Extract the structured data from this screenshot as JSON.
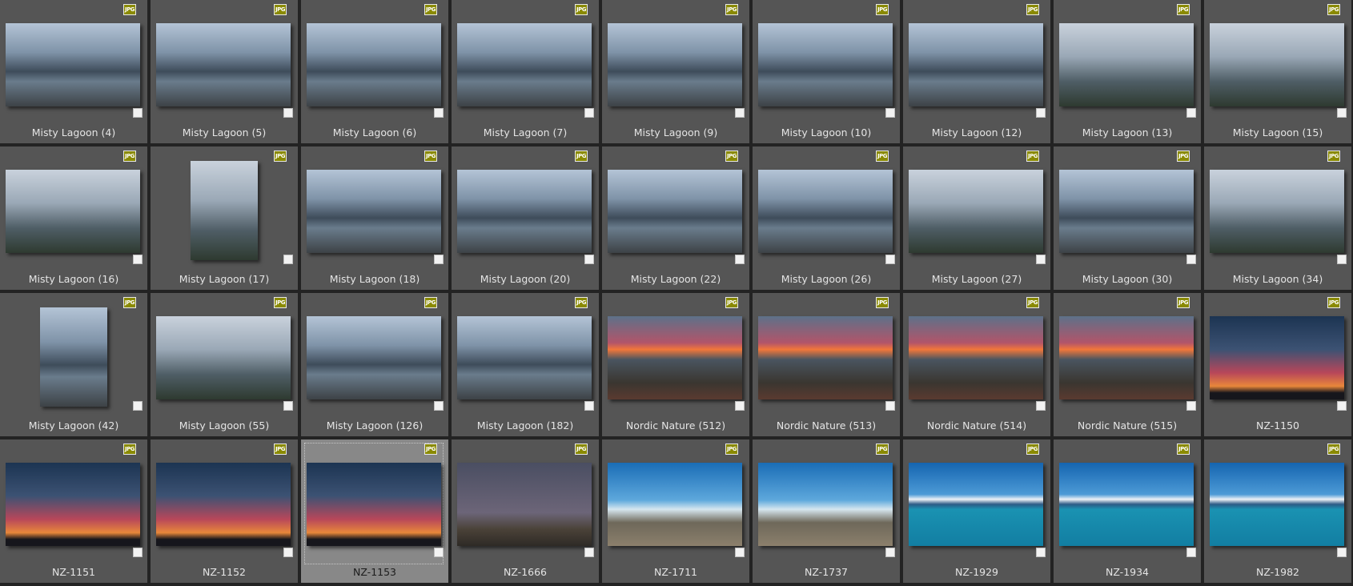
{
  "badge_text": "JPG",
  "palettes": {
    "misty": "linear-gradient(180deg,#b4c4d6 0%,#7f93a8 35%,#3e4c5a 58%,#6a7c8c 70%,#3d4246 100%)",
    "fog": "linear-gradient(180deg,#c9d2dc 0%,#9aa8b6 40%,#4f5e66 70%,#2e3a30 100%)",
    "nordic": "linear-gradient(180deg,#5d7189 0%,#b2556a 32%,#f2773a 40%,#4a5560 52%,#3a3630 80%,#5a3a30 100%)",
    "dusk": "linear-gradient(180deg,#1c3452 0%,#3c5273 40%,#b8475a 68%,#e8873a 84%,#16161c 92%)",
    "grey": "linear-gradient(180deg,#4a4e62 0%,#6c6578 60%,#4a4238 80%,#2e2a26 100%)",
    "beach": "linear-gradient(180deg,#1a6db6 0%,#5ea8dc 45%,#d6e6ef 56%,#6e685a 72%,#8c806c 100%)",
    "lake": "linear-gradient(180deg,#1565b0 0%,#4c9ad6 38%,#eef2f6 44%,#2b5a86 50%,#1a92b2 56%,#127ea2 100%)"
  },
  "items": [
    {
      "label": "Misty Lagoon (4)",
      "p": "misty"
    },
    {
      "label": "Misty Lagoon (5)",
      "p": "misty"
    },
    {
      "label": "Misty Lagoon (6)",
      "p": "misty"
    },
    {
      "label": "Misty Lagoon (7)",
      "p": "misty"
    },
    {
      "label": "Misty Lagoon (9)",
      "p": "misty"
    },
    {
      "label": "Misty Lagoon (10)",
      "p": "misty"
    },
    {
      "label": "Misty Lagoon (12)",
      "p": "misty"
    },
    {
      "label": "Misty Lagoon (13)",
      "p": "fog"
    },
    {
      "label": "Misty Lagoon (15)",
      "p": "fog"
    },
    {
      "label": "Misty Lagoon (16)",
      "p": "fog"
    },
    {
      "label": "Misty Lagoon (17)",
      "p": "fog",
      "portrait": true
    },
    {
      "label": "Misty Lagoon (18)",
      "p": "misty"
    },
    {
      "label": "Misty Lagoon (20)",
      "p": "misty"
    },
    {
      "label": "Misty Lagoon (22)",
      "p": "misty"
    },
    {
      "label": "Misty Lagoon (26)",
      "p": "misty"
    },
    {
      "label": "Misty Lagoon (27)",
      "p": "fog"
    },
    {
      "label": "Misty Lagoon (30)",
      "p": "misty"
    },
    {
      "label": "Misty Lagoon (34)",
      "p": "fog"
    },
    {
      "label": "Misty Lagoon (42)",
      "p": "misty",
      "portrait": true
    },
    {
      "label": "Misty Lagoon (55)",
      "p": "fog"
    },
    {
      "label": "Misty Lagoon (126)",
      "p": "misty"
    },
    {
      "label": "Misty Lagoon (182)",
      "p": "misty"
    },
    {
      "label": "Nordic Nature (512)",
      "p": "nordic"
    },
    {
      "label": "Nordic Nature (513)",
      "p": "nordic"
    },
    {
      "label": "Nordic Nature (514)",
      "p": "nordic"
    },
    {
      "label": "Nordic Nature (515)",
      "p": "nordic"
    },
    {
      "label": "NZ-1150",
      "p": "dusk"
    },
    {
      "label": "NZ-1151",
      "p": "dusk"
    },
    {
      "label": "NZ-1152",
      "p": "dusk"
    },
    {
      "label": "NZ-1153",
      "p": "dusk",
      "selected": true
    },
    {
      "label": "NZ-1666",
      "p": "grey"
    },
    {
      "label": "NZ-1711",
      "p": "beach"
    },
    {
      "label": "NZ-1737",
      "p": "beach"
    },
    {
      "label": "NZ-1929",
      "p": "lake"
    },
    {
      "label": "NZ-1934",
      "p": "lake"
    },
    {
      "label": "NZ-1982",
      "p": "lake"
    }
  ]
}
